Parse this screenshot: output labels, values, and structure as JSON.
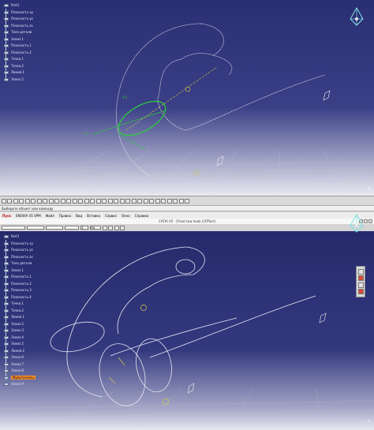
{
  "tree_top": {
    "root_label": "Part1",
    "items": [
      "Плоскость ху",
      "Плоскость yz",
      "Плоскость zx",
      "Тело детали",
      "Эскиз.1",
      "Плоскость.1",
      "Плоскость.2",
      "Точка.1",
      "Точка.2",
      "Линия.1",
      "Эскиз.2"
    ]
  },
  "tree_bottom": {
    "root_label": "Part1",
    "items": [
      "Плоскость ху",
      "Плоскость yz",
      "Плоскость zx",
      "Тело детали",
      "Эскиз.1",
      "Плоскость.1",
      "Плоскость.2",
      "Плоскость.3",
      "Плоскость.4",
      "Точка.1",
      "Точка.2",
      "Линия.1",
      "Эскиз.2",
      "Эскиз.3",
      "Эскиз.4",
      "Эскиз.5",
      "Линия.2",
      "Эскиз.6",
      "Эскиз.7",
      "Эскиз.8",
      "Мульти-секц",
      "Эскиз.9"
    ],
    "selected_index": 20
  },
  "status_text": "Выберите объект или команду",
  "menu": {
    "items": [
      "Пуск",
      "ENOVIA V5 VPM",
      "Файл",
      "Правка",
      "Вид",
      "Вставка",
      "Сервис",
      "Окно",
      "Справка"
    ]
  },
  "window_title": "CATIA V5 - [Front tow hook.CATPart]",
  "format_bar": {
    "value1": "1",
    "value2": "Aa"
  },
  "colors": {
    "viewport_top": "#2a2e72",
    "curve": "#e0e0ee",
    "highlight": "#2ecc40",
    "accent_yellow": "#d8c84a",
    "selected_item": "#f08a2a"
  },
  "icons": {
    "compass": "compass-icon",
    "tree_node": "tree-node-icon"
  }
}
